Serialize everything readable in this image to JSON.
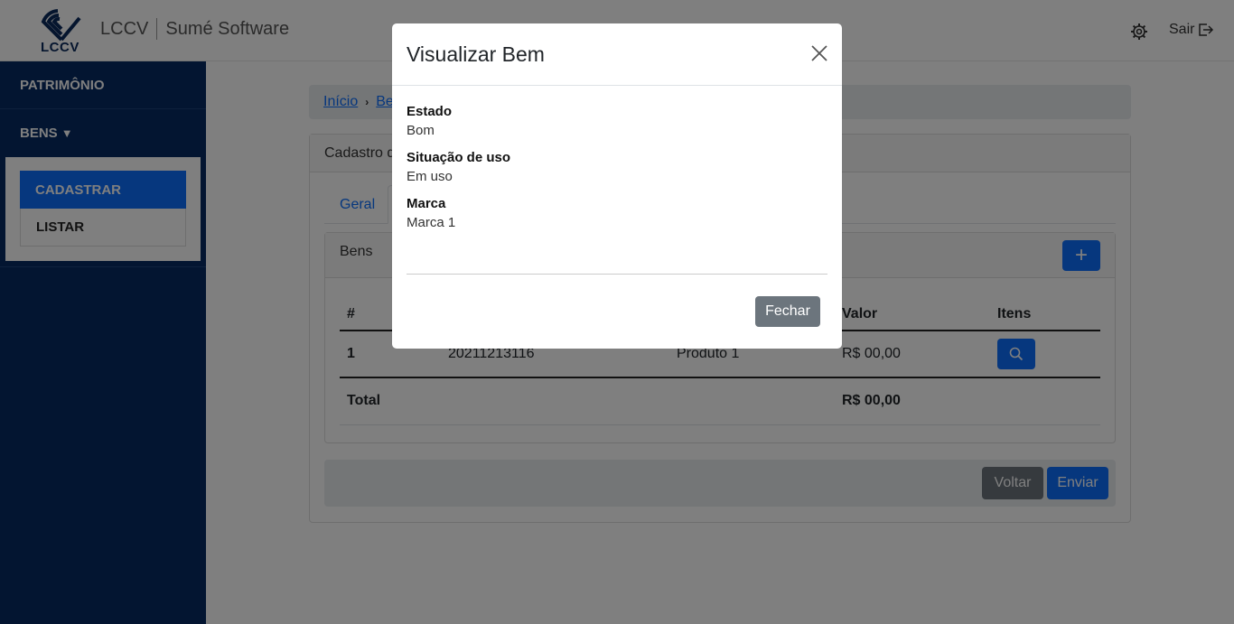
{
  "header": {
    "logo_text": "LCCV",
    "brand_left": "LCCV",
    "brand_right": "Sumé Software",
    "logout_label": "Sair"
  },
  "sidebar": {
    "items": [
      {
        "label": "PATRIMÔNIO"
      },
      {
        "label": "BENS"
      }
    ],
    "bens_submenu": [
      {
        "label": "CADASTRAR",
        "active": true
      },
      {
        "label": "LISTAR",
        "active": false
      }
    ]
  },
  "breadcrumb": {
    "home": "Início",
    "current": "Be"
  },
  "card": {
    "title": "Cadastro d",
    "tabs": [
      {
        "label": "Geral",
        "active": false
      }
    ],
    "inner_title": "Bens",
    "table": {
      "headers": [
        "#",
        "Valor",
        "Itens"
      ],
      "rows": [
        {
          "num": "1",
          "code": "20211213116",
          "product": "Produto 1",
          "valor": "R$ 00,00"
        }
      ],
      "total_label": "Total",
      "total_value": "R$ 00,00"
    },
    "buttons": {
      "voltar": "Voltar",
      "enviar": "Enviar"
    }
  },
  "modal": {
    "title": "Visualizar Bem",
    "fields": [
      {
        "label": "Estado",
        "value": "Bom"
      },
      {
        "label": "Situação de uso",
        "value": "Em uso"
      },
      {
        "label": "Marca",
        "value": "Marca 1"
      }
    ],
    "close_button": "Fechar"
  },
  "colors": {
    "primary": "#0d6efd",
    "secondary": "#6c757d",
    "sidebar": "#062a63"
  }
}
